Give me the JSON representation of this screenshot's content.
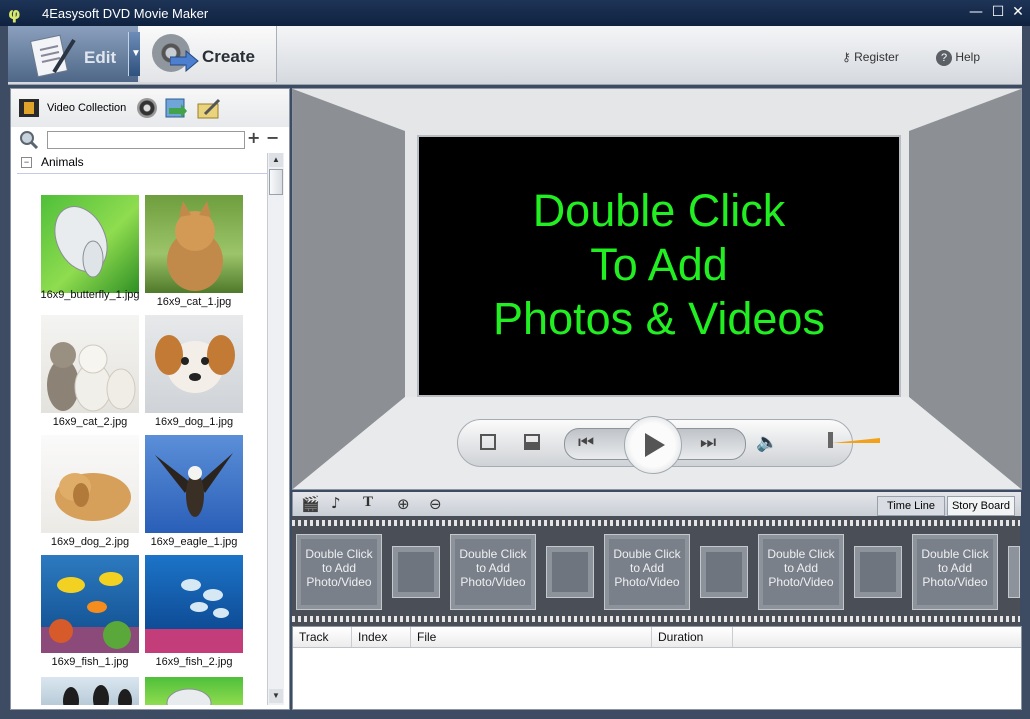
{
  "window": {
    "title": "4Easysoft DVD Movie Maker",
    "minimize": "—",
    "maximize": "☐",
    "close": "✕"
  },
  "toolbar": {
    "edit_label": "Edit",
    "create_label": "Create",
    "register_label": "Register",
    "help_label": "Help"
  },
  "left_panel": {
    "tab_label": "Video Collection",
    "search_placeholder": "",
    "add_glyph": "+",
    "remove_glyph": "−",
    "group_label": "Animals",
    "items": [
      {
        "label": "16x9_butterfly_1.jpg"
      },
      {
        "label": "16x9_cat_1.jpg"
      },
      {
        "label": "16x9_cat_2.jpg"
      },
      {
        "label": "16x9_dog_1.jpg"
      },
      {
        "label": "16x9_dog_2.jpg"
      },
      {
        "label": "16x9_eagle_1.jpg"
      },
      {
        "label": "16x9_fish_1.jpg"
      },
      {
        "label": "16x9_fish_2.jpg"
      }
    ]
  },
  "preview": {
    "line1": "Double Click",
    "line2": "To Add",
    "line3": "Photos & Videos"
  },
  "timeline": {
    "tab_timeline": "Time Line",
    "tab_storyboard": "Story Board",
    "slot_line1": "Double Click",
    "slot_line2": "to Add",
    "slot_line3": "Photo/Video"
  },
  "table": {
    "columns": [
      "Track",
      "Index",
      "File",
      "Duration"
    ]
  },
  "colors": {
    "title_bar": "#0f2240",
    "screen_text": "#21ef21",
    "screen_bg": "#000000"
  }
}
